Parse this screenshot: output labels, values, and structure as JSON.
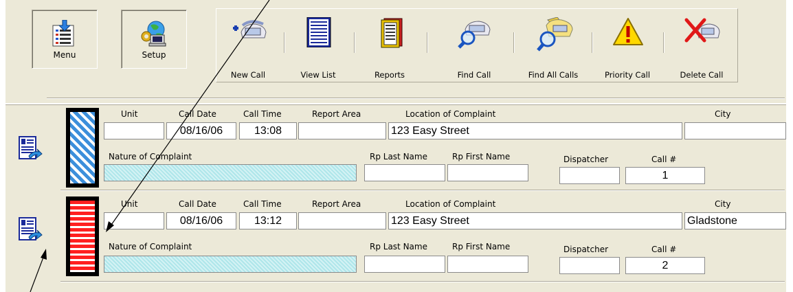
{
  "toolbar": {
    "menu_label": "Menu",
    "setup_label": "Setup",
    "tools": [
      {
        "label": "New Call",
        "icon": "new-call-icon"
      },
      {
        "label": "View List",
        "icon": "view-list-icon"
      },
      {
        "label": "Reports",
        "icon": "reports-icon"
      },
      {
        "label": "Find Call",
        "icon": "find-call-icon"
      },
      {
        "label": "Find All Calls",
        "icon": "find-all-calls-icon"
      },
      {
        "label": "Priority Call",
        "icon": "priority-warning-icon"
      },
      {
        "label": "Delete Call",
        "icon": "delete-call-icon"
      }
    ]
  },
  "labels": {
    "unit": "Unit",
    "call_date": "Call Date",
    "call_time": "Call Time",
    "report_area": "Report Area",
    "location": "Location of Complaint",
    "city": "City",
    "nature": "Nature of Complaint",
    "rp_last": "Rp Last Name",
    "rp_first": "Rp First Name",
    "dispatcher": "Dispatcher",
    "call_no": "Call #"
  },
  "records": [
    {
      "status_pattern": "blue-diagonal",
      "unit": "",
      "call_date": "08/16/06",
      "call_time": "13:08",
      "report_area": "",
      "location": "123 Easy Street",
      "city": "",
      "nature": "",
      "rp_last": "",
      "rp_first": "",
      "dispatcher": "",
      "call_no": "1"
    },
    {
      "status_pattern": "red-horizontal",
      "unit": "",
      "call_date": "08/16/06",
      "call_time": "13:12",
      "report_area": "",
      "location": "123 Easy Street",
      "city": "Gladstone",
      "nature": "",
      "rp_last": "",
      "rp_first": "",
      "dispatcher": "",
      "call_no": "2"
    }
  ],
  "colors": {
    "panel": "#ece9d8",
    "priority_blue": "#3c8fdb",
    "priority_red": "#ff2020",
    "nature_hatch": "#aee6ea"
  }
}
